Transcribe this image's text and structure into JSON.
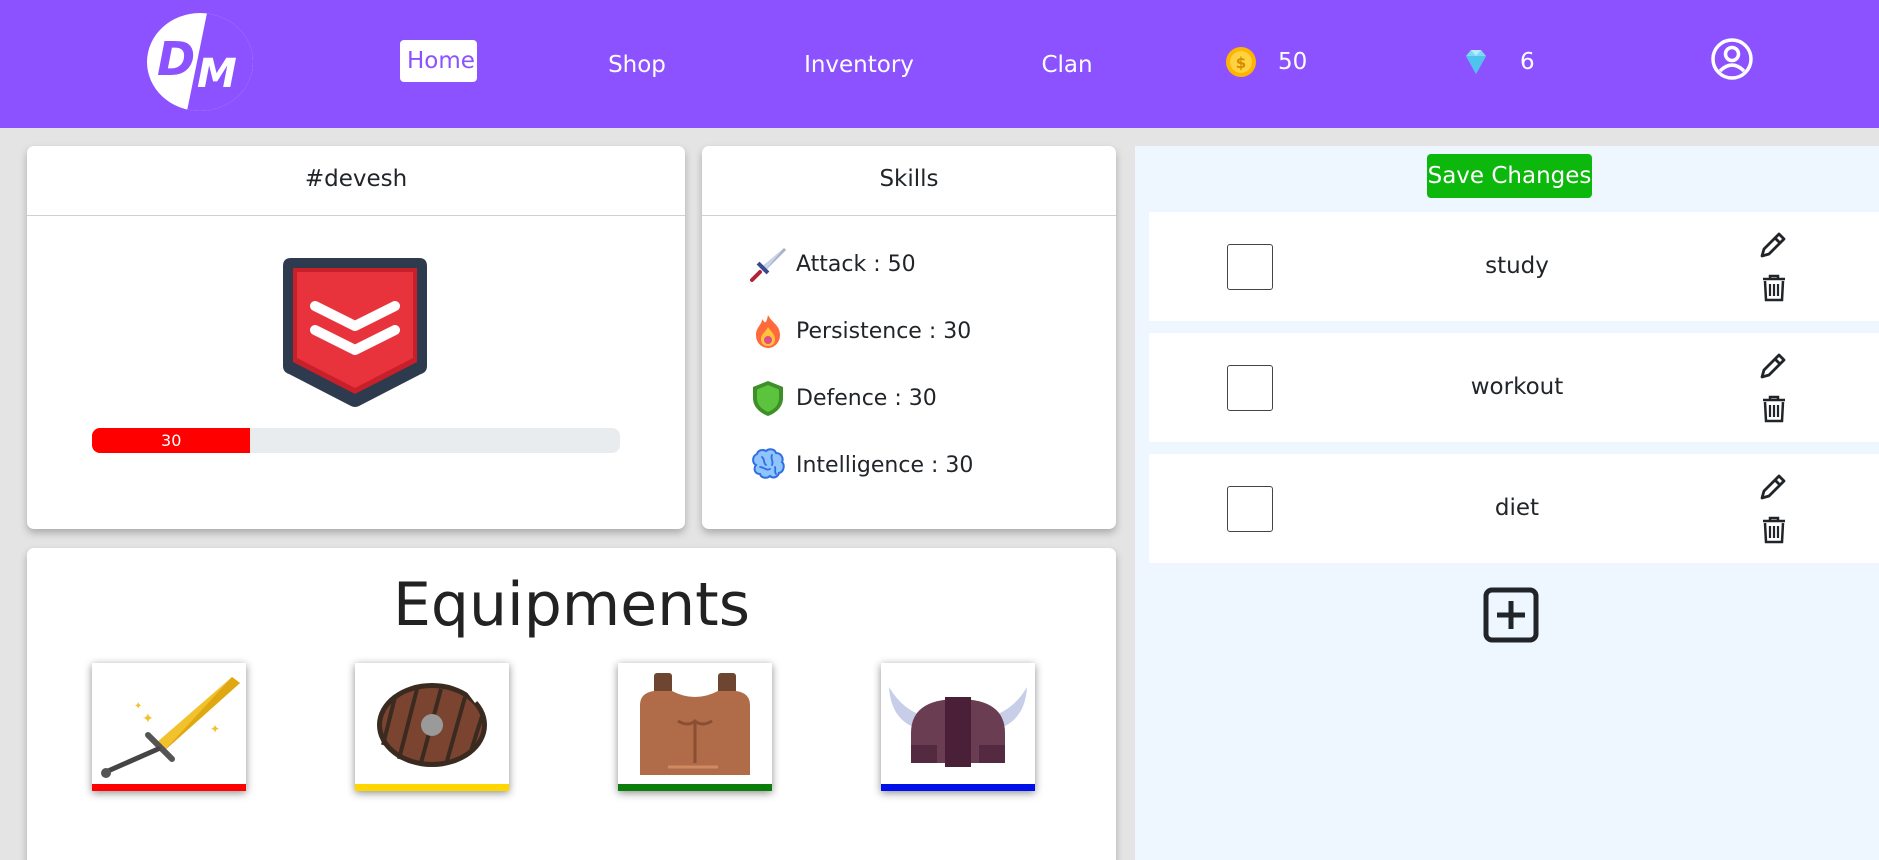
{
  "brand": {
    "logo_text": "DM"
  },
  "nav": {
    "home": "Home",
    "shop": "Shop",
    "inventory": "Inventory",
    "clan": "Clan",
    "coins": "50",
    "gems": "6"
  },
  "colors": {
    "nav_bg": "#8c52ff",
    "save_button": "#0cb80c",
    "xp_bar": "#ff0000"
  },
  "profile": {
    "username": "#devesh",
    "xp_value": "30",
    "xp_fraction": 0.3
  },
  "skills": {
    "header": "Skills",
    "items": [
      {
        "label": "Attack : 50",
        "icon": "sword-icon"
      },
      {
        "label": "Persistence : 30",
        "icon": "flame-icon"
      },
      {
        "label": "Defence : 30",
        "icon": "shield-icon"
      },
      {
        "label": "Intelligence : 30",
        "icon": "brain-icon"
      }
    ]
  },
  "equipment": {
    "title": "Equipments",
    "items": [
      {
        "icon": "sword-icon",
        "stripe": "#ff0000"
      },
      {
        "icon": "round-shield-icon",
        "stripe": "#ffd600"
      },
      {
        "icon": "armor-icon",
        "stripe": "#0a7d0a"
      },
      {
        "icon": "viking-helmet-icon",
        "stripe": "#0010e8"
      }
    ]
  },
  "tasks": {
    "save_label": "Save Changes",
    "items": [
      {
        "name": "study"
      },
      {
        "name": "workout"
      },
      {
        "name": "diet"
      }
    ]
  }
}
